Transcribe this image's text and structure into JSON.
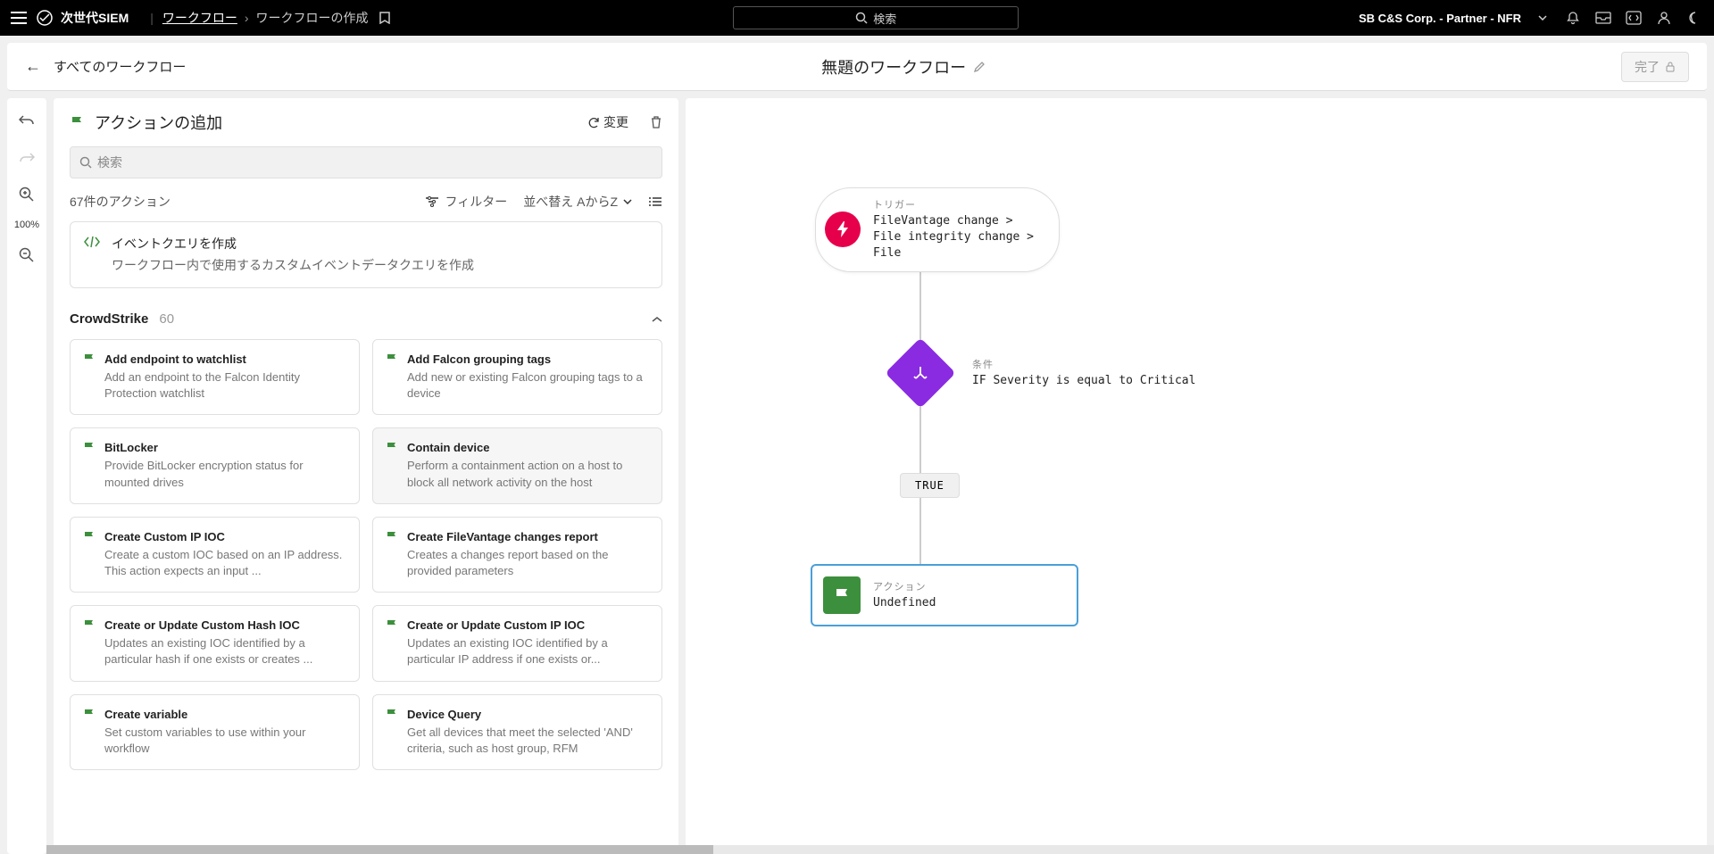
{
  "topbar": {
    "brand": "次世代SIEM",
    "crumb1": "ワークフロー",
    "crumb2": "ワークフローの作成",
    "search_placeholder": "検索",
    "corp": "SB C&S Corp. - Partner - NFR"
  },
  "subheader": {
    "back_label": "すべてのワークフロー",
    "title": "無題のワークフロー",
    "done_label": "完了"
  },
  "toolstrip": {
    "zoom": "100%"
  },
  "panel": {
    "title": "アクションの追加",
    "change_btn": "変更",
    "search_placeholder": "検索",
    "count_label": "67件のアクション",
    "filter_label": "フィルター",
    "sort_label": "並べ替え AからZ",
    "event_card": {
      "title": "イベントクエリを作成",
      "desc": "ワークフロー内で使用するカスタムイベントデータクエリを作成"
    },
    "group": {
      "name": "CrowdStrike",
      "count": "60"
    },
    "actions": [
      {
        "title": "Add endpoint to watchlist",
        "desc": "Add an endpoint to the Falcon Identity Protection watchlist",
        "hover": false
      },
      {
        "title": "Add Falcon grouping tags",
        "desc": "Add new or existing Falcon grouping tags to a device",
        "hover": false
      },
      {
        "title": "BitLocker",
        "desc": "Provide BitLocker encryption status for mounted drives",
        "hover": false
      },
      {
        "title": "Contain device",
        "desc": "Perform a containment action on a host to block all network activity on the host",
        "hover": true
      },
      {
        "title": "Create Custom IP IOC",
        "desc": "Create a custom IOC based on an IP address. This action expects an input ...",
        "hover": false
      },
      {
        "title": "Create FileVantage changes report",
        "desc": "Creates a changes report based on the provided parameters",
        "hover": false
      },
      {
        "title": "Create or Update Custom Hash IOC",
        "desc": "Updates an existing IOC identified by a particular hash if one exists or creates ...",
        "hover": false
      },
      {
        "title": "Create or Update Custom IP IOC",
        "desc": "Updates an existing IOC identified by a particular IP address if one exists or...",
        "hover": false
      },
      {
        "title": "Create variable",
        "desc": "Set custom variables to use within your workflow",
        "hover": false
      },
      {
        "title": "Device Query",
        "desc": "Get all devices that meet the selected 'AND' criteria, such as host group, RFM",
        "hover": false
      }
    ]
  },
  "canvas": {
    "trigger": {
      "label": "トリガー",
      "text": "FileVantage change > File integrity change > File"
    },
    "condition": {
      "label": "条件",
      "text": "IF Severity is equal to Critical"
    },
    "true_badge": "TRUE",
    "action": {
      "label": "アクション",
      "text": "Undefined"
    }
  }
}
